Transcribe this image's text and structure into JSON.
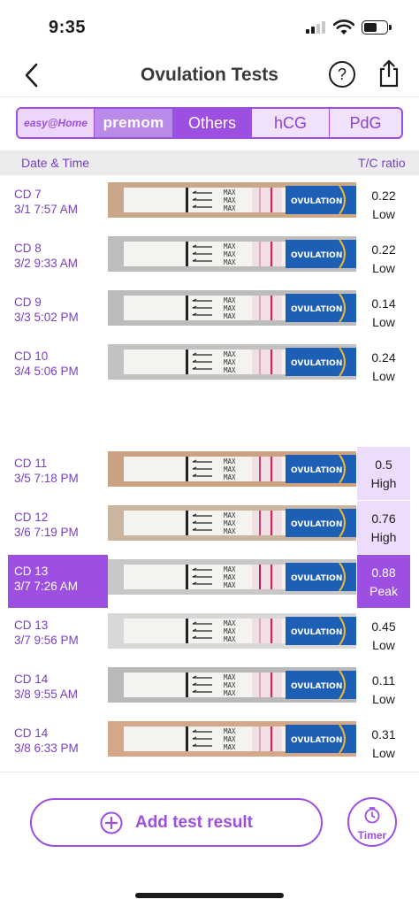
{
  "status_bar": {
    "time": "9:35"
  },
  "nav": {
    "title": "Ovulation Tests",
    "help_label": "?"
  },
  "brand_tabs": [
    {
      "label": "easy@Home",
      "selected": false
    },
    {
      "label": "premom",
      "selected": false
    },
    {
      "label": "Others",
      "selected": true
    },
    {
      "label": "hCG",
      "selected": false
    },
    {
      "label": "PdG",
      "selected": false
    }
  ],
  "table": {
    "header": {
      "date_time": "Date & Time",
      "ratio": "T/C ratio"
    },
    "rows": [
      {
        "cd": "CD 7",
        "datetime": "3/1 7:57 AM",
        "ratio": "0.22",
        "level": "Low",
        "highlight": "none",
        "strip_brand": "OVULATION",
        "strip_max": "MAX"
      },
      {
        "cd": "CD 8",
        "datetime": "3/2 9:33 AM",
        "ratio": "0.22",
        "level": "Low",
        "highlight": "none",
        "strip_brand": "OVULATION",
        "strip_max": "MAX"
      },
      {
        "cd": "CD 9",
        "datetime": "3/3 5:02 PM",
        "ratio": "0.14",
        "level": "Low",
        "highlight": "none",
        "strip_brand": "OVULATION",
        "strip_max": "MAX"
      },
      {
        "cd": "CD 10",
        "datetime": "3/4 5:06 PM",
        "ratio": "0.24",
        "level": "Low",
        "highlight": "none",
        "strip_brand": "OVULATION",
        "strip_max": "MAX"
      },
      {
        "cd": "CD 11",
        "datetime": "3/5 7:18 PM",
        "ratio": "0.5",
        "level": "High",
        "highlight": "high",
        "strip_brand": "OVULATION",
        "strip_max": "MAX"
      },
      {
        "cd": "CD 12",
        "datetime": "3/6 7:19 PM",
        "ratio": "0.76",
        "level": "High",
        "highlight": "high",
        "strip_brand": "OVULATION",
        "strip_max": "MAX"
      },
      {
        "cd": "CD 13",
        "datetime": "3/7 7:26 AM",
        "ratio": "0.88",
        "level": "Peak",
        "highlight": "peak",
        "strip_brand": "OVULATION",
        "strip_max": "MAX"
      },
      {
        "cd": "CD 13",
        "datetime": "3/7 9:56 PM",
        "ratio": "0.45",
        "level": "Low",
        "highlight": "none",
        "strip_brand": "OVULATION",
        "strip_max": "MAX"
      },
      {
        "cd": "CD 14",
        "datetime": "3/8 9:55 AM",
        "ratio": "0.11",
        "level": "Low",
        "highlight": "none",
        "strip_brand": "OVULATION",
        "strip_max": "MAX"
      },
      {
        "cd": "CD 14",
        "datetime": "3/8 6:33 PM",
        "ratio": "0.31",
        "level": "Low",
        "highlight": "none",
        "strip_brand": "OVULATION",
        "strip_max": "MAX"
      }
    ]
  },
  "actions": {
    "add_label": "Add test result",
    "timer_label": "Timer"
  },
  "colors": {
    "accent": "#9c4fe0",
    "high_bg": "#eddcfc",
    "label_text": "#7a3fc4"
  },
  "icons": [
    "chevron-left-icon",
    "help-icon",
    "share-icon",
    "plus-circle-icon",
    "timer-icon"
  ]
}
